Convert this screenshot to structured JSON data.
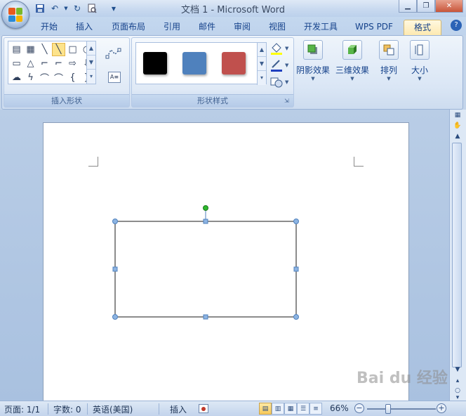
{
  "window": {
    "title": "文档 1 - Microsoft Word",
    "minimize_icon": "minimize-icon",
    "maximize_icon": "restore-icon",
    "close_icon": "close-icon"
  },
  "quick_access": [
    "save-icon",
    "undo-icon",
    "redo-icon",
    "print-preview-icon",
    "customize-icon"
  ],
  "tabs": [
    {
      "label": "开始"
    },
    {
      "label": "插入"
    },
    {
      "label": "页面布局"
    },
    {
      "label": "引用"
    },
    {
      "label": "邮件"
    },
    {
      "label": "审阅"
    },
    {
      "label": "视图"
    },
    {
      "label": "开发工具"
    },
    {
      "label": "WPS PDF"
    },
    {
      "label": "格式",
      "active": true
    }
  ],
  "ribbon": {
    "insert_shapes": {
      "label": "插入形状",
      "shapes": [
        "▤",
        "▦",
        "╲",
        "╲",
        "□",
        "○",
        "▭",
        "△",
        "⌐",
        "⌐",
        "⇨",
        "⇩",
        "☁",
        "ϟ",
        "⌒",
        "⌒",
        "{",
        "}"
      ]
    },
    "shape_styles": {
      "label": "形状样式",
      "swatches": [
        {
          "color": "#000000"
        },
        {
          "color": "#4f81bd"
        },
        {
          "color": "#c0504d"
        }
      ],
      "fill_icon": "paint-bucket-icon",
      "outline_icon": "pen-outline-icon",
      "change_shape_icon": "change-shape-icon"
    },
    "shadow_effects": {
      "label": "阴影效果"
    },
    "three_d_effects": {
      "label": "三维效果"
    },
    "arrange": {
      "label": "排列"
    },
    "size": {
      "label": "大小"
    }
  },
  "status": {
    "page": "页面: 1/1",
    "words": "字数: 0",
    "language": "英语(美国)",
    "insert_mode": "插入",
    "zoom": "66%",
    "zoom_level": 0.66
  },
  "watermark": "Bai du 经验",
  "colors": {
    "selection_handle": "#4f81bd",
    "rotate_handle": "#2db82d"
  }
}
